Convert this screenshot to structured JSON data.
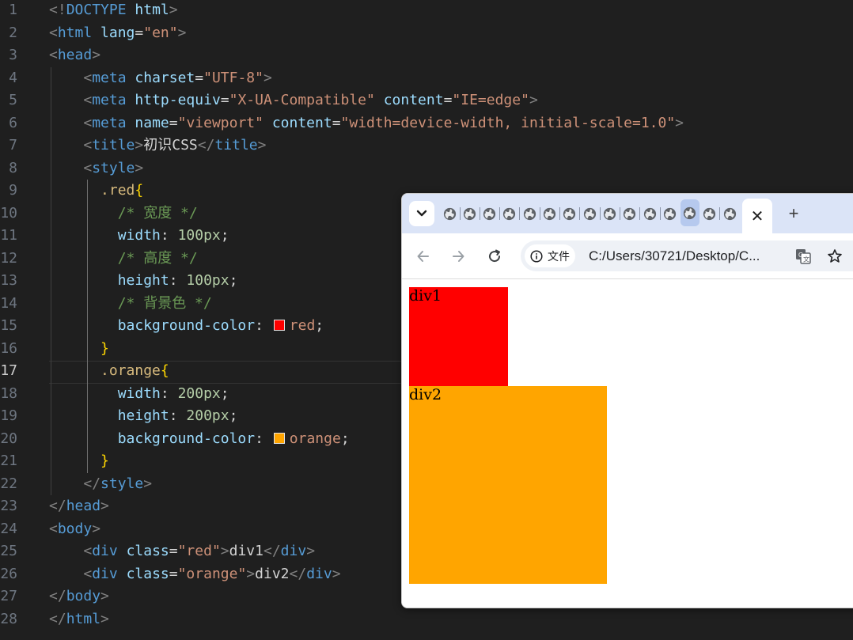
{
  "editor": {
    "active_line": 17,
    "lines": [
      {
        "n": "1",
        "tokens": [
          [
            "<!",
            "punct"
          ],
          [
            "DOCTYPE",
            "tag"
          ],
          [
            " ",
            "text"
          ],
          [
            "html",
            "attr"
          ],
          [
            ">",
            "punct"
          ]
        ]
      },
      {
        "n": "2",
        "tokens": [
          [
            "<",
            "punct"
          ],
          [
            "html",
            "tag"
          ],
          [
            " ",
            "text"
          ],
          [
            "lang",
            "attr"
          ],
          [
            "=",
            "text"
          ],
          [
            "\"en\"",
            "str"
          ],
          [
            ">",
            "punct"
          ]
        ]
      },
      {
        "n": "3",
        "tokens": [
          [
            "<",
            "punct"
          ],
          [
            "head",
            "tag"
          ],
          [
            ">",
            "punct"
          ]
        ]
      },
      {
        "n": "4",
        "tokens": [
          [
            "    ",
            "text"
          ],
          [
            "<",
            "punct"
          ],
          [
            "meta",
            "tag"
          ],
          [
            " ",
            "text"
          ],
          [
            "charset",
            "attr"
          ],
          [
            "=",
            "text"
          ],
          [
            "\"UTF-8\"",
            "str"
          ],
          [
            ">",
            "punct"
          ]
        ]
      },
      {
        "n": "5",
        "tokens": [
          [
            "    ",
            "text"
          ],
          [
            "<",
            "punct"
          ],
          [
            "meta",
            "tag"
          ],
          [
            " ",
            "text"
          ],
          [
            "http-equiv",
            "attr"
          ],
          [
            "=",
            "text"
          ],
          [
            "\"X-UA-Compatible\"",
            "str"
          ],
          [
            " ",
            "text"
          ],
          [
            "content",
            "attr"
          ],
          [
            "=",
            "text"
          ],
          [
            "\"IE=edge\"",
            "str"
          ],
          [
            ">",
            "punct"
          ]
        ]
      },
      {
        "n": "6",
        "tokens": [
          [
            "    ",
            "text"
          ],
          [
            "<",
            "punct"
          ],
          [
            "meta",
            "tag"
          ],
          [
            " ",
            "text"
          ],
          [
            "name",
            "attr"
          ],
          [
            "=",
            "text"
          ],
          [
            "\"viewport\"",
            "str"
          ],
          [
            " ",
            "text"
          ],
          [
            "content",
            "attr"
          ],
          [
            "=",
            "text"
          ],
          [
            "\"width=device-width, initial-scale=1.0\"",
            "str"
          ],
          [
            ">",
            "punct"
          ]
        ]
      },
      {
        "n": "7",
        "tokens": [
          [
            "    ",
            "text"
          ],
          [
            "<",
            "punct"
          ],
          [
            "title",
            "tag"
          ],
          [
            ">",
            "punct"
          ],
          [
            "初识CSS",
            "text"
          ],
          [
            "</",
            "punct"
          ],
          [
            "title",
            "tag"
          ],
          [
            ">",
            "punct"
          ]
        ]
      },
      {
        "n": "8",
        "tokens": [
          [
            "    ",
            "text"
          ],
          [
            "<",
            "punct"
          ],
          [
            "style",
            "tag"
          ],
          [
            ">",
            "punct"
          ]
        ]
      },
      {
        "n": "9",
        "tokens": [
          [
            "      ",
            "text"
          ],
          [
            ".red",
            "sel"
          ],
          [
            "{",
            "brace"
          ]
        ]
      },
      {
        "n": "10",
        "tokens": [
          [
            "        ",
            "text"
          ],
          [
            "/* 宽度 */",
            "comm"
          ]
        ]
      },
      {
        "n": "11",
        "tokens": [
          [
            "        ",
            "text"
          ],
          [
            "width",
            "attr"
          ],
          [
            ": ",
            "text"
          ],
          [
            "100px",
            "num"
          ],
          [
            ";",
            "text"
          ]
        ]
      },
      {
        "n": "12",
        "tokens": [
          [
            "        ",
            "text"
          ],
          [
            "/* 高度 */",
            "comm"
          ]
        ]
      },
      {
        "n": "13",
        "tokens": [
          [
            "        ",
            "text"
          ],
          [
            "height",
            "attr"
          ],
          [
            ": ",
            "text"
          ],
          [
            "100px",
            "num"
          ],
          [
            ";",
            "text"
          ]
        ]
      },
      {
        "n": "14",
        "tokens": [
          [
            "        ",
            "text"
          ],
          [
            "/* 背景色 */",
            "comm"
          ]
        ]
      },
      {
        "n": "15",
        "tokens": [
          [
            "        ",
            "text"
          ],
          [
            "background-color",
            "attr"
          ],
          [
            ": ",
            "text"
          ],
          [
            "#ff0000",
            "swatch"
          ],
          [
            "red",
            "str"
          ],
          [
            ";",
            "text"
          ]
        ]
      },
      {
        "n": "16",
        "tokens": [
          [
            "      ",
            "text"
          ],
          [
            "}",
            "brace"
          ]
        ]
      },
      {
        "n": "17",
        "tokens": [
          [
            "      ",
            "text"
          ],
          [
            ".orange",
            "sel"
          ],
          [
            "{",
            "brace"
          ]
        ]
      },
      {
        "n": "18",
        "tokens": [
          [
            "        ",
            "text"
          ],
          [
            "width",
            "attr"
          ],
          [
            ": ",
            "text"
          ],
          [
            "200px",
            "num"
          ],
          [
            ";",
            "text"
          ]
        ]
      },
      {
        "n": "19",
        "tokens": [
          [
            "        ",
            "text"
          ],
          [
            "height",
            "attr"
          ],
          [
            ": ",
            "text"
          ],
          [
            "200px",
            "num"
          ],
          [
            ";",
            "text"
          ]
        ]
      },
      {
        "n": "20",
        "tokens": [
          [
            "        ",
            "text"
          ],
          [
            "background-color",
            "attr"
          ],
          [
            ": ",
            "text"
          ],
          [
            "#ffa500",
            "swatch"
          ],
          [
            "orange",
            "str"
          ],
          [
            ";",
            "text"
          ]
        ]
      },
      {
        "n": "21",
        "tokens": [
          [
            "      ",
            "text"
          ],
          [
            "}",
            "brace"
          ]
        ]
      },
      {
        "n": "22",
        "tokens": [
          [
            "    ",
            "text"
          ],
          [
            "</",
            "punct"
          ],
          [
            "style",
            "tag"
          ],
          [
            ">",
            "punct"
          ]
        ]
      },
      {
        "n": "23",
        "tokens": [
          [
            "</",
            "punct"
          ],
          [
            "head",
            "tag"
          ],
          [
            ">",
            "punct"
          ]
        ]
      },
      {
        "n": "24",
        "tokens": [
          [
            "<",
            "punct"
          ],
          [
            "body",
            "tag"
          ],
          [
            ">",
            "punct"
          ]
        ]
      },
      {
        "n": "25",
        "tokens": [
          [
            "    ",
            "text"
          ],
          [
            "<",
            "punct"
          ],
          [
            "div",
            "tag"
          ],
          [
            " ",
            "text"
          ],
          [
            "class",
            "attr"
          ],
          [
            "=",
            "text"
          ],
          [
            "\"red\"",
            "str"
          ],
          [
            ">",
            "punct"
          ],
          [
            "div1",
            "text"
          ],
          [
            "</",
            "punct"
          ],
          [
            "div",
            "tag"
          ],
          [
            ">",
            "punct"
          ]
        ]
      },
      {
        "n": "26",
        "tokens": [
          [
            "    ",
            "text"
          ],
          [
            "<",
            "punct"
          ],
          [
            "div",
            "tag"
          ],
          [
            " ",
            "text"
          ],
          [
            "class",
            "attr"
          ],
          [
            "=",
            "text"
          ],
          [
            "\"orange\"",
            "str"
          ],
          [
            ">",
            "punct"
          ],
          [
            "div2",
            "text"
          ],
          [
            "</",
            "punct"
          ],
          [
            "div",
            "tag"
          ],
          [
            ">",
            "punct"
          ]
        ]
      },
      {
        "n": "27",
        "tokens": [
          [
            "</",
            "punct"
          ],
          [
            "body",
            "tag"
          ],
          [
            ">",
            "punct"
          ]
        ]
      },
      {
        "n": "28",
        "tokens": [
          [
            "</",
            "punct"
          ],
          [
            "html",
            "tag"
          ],
          [
            ">",
            "punct"
          ]
        ]
      }
    ]
  },
  "browser": {
    "tab_search_icon": "chevron-down-icon",
    "tab_count_globe": 15,
    "selected_globe_index": 12,
    "active_tab_icon": "close-icon",
    "active_tab_close": "✕",
    "new_tab_label": "+",
    "toolbar": {
      "back_icon": "arrow-left-icon",
      "forward_icon": "arrow-right-icon",
      "reload_icon": "reload-icon"
    },
    "omnibox": {
      "chip_label": "文件",
      "url": "C:/Users/30721/Desktop/C...",
      "translate_icon": "translate-icon",
      "bookmark_icon": "star-icon"
    },
    "page": {
      "div1": {
        "text": "div1",
        "color": "#ff0000"
      },
      "div2": {
        "text": "div2",
        "color": "#ffa500"
      }
    }
  }
}
